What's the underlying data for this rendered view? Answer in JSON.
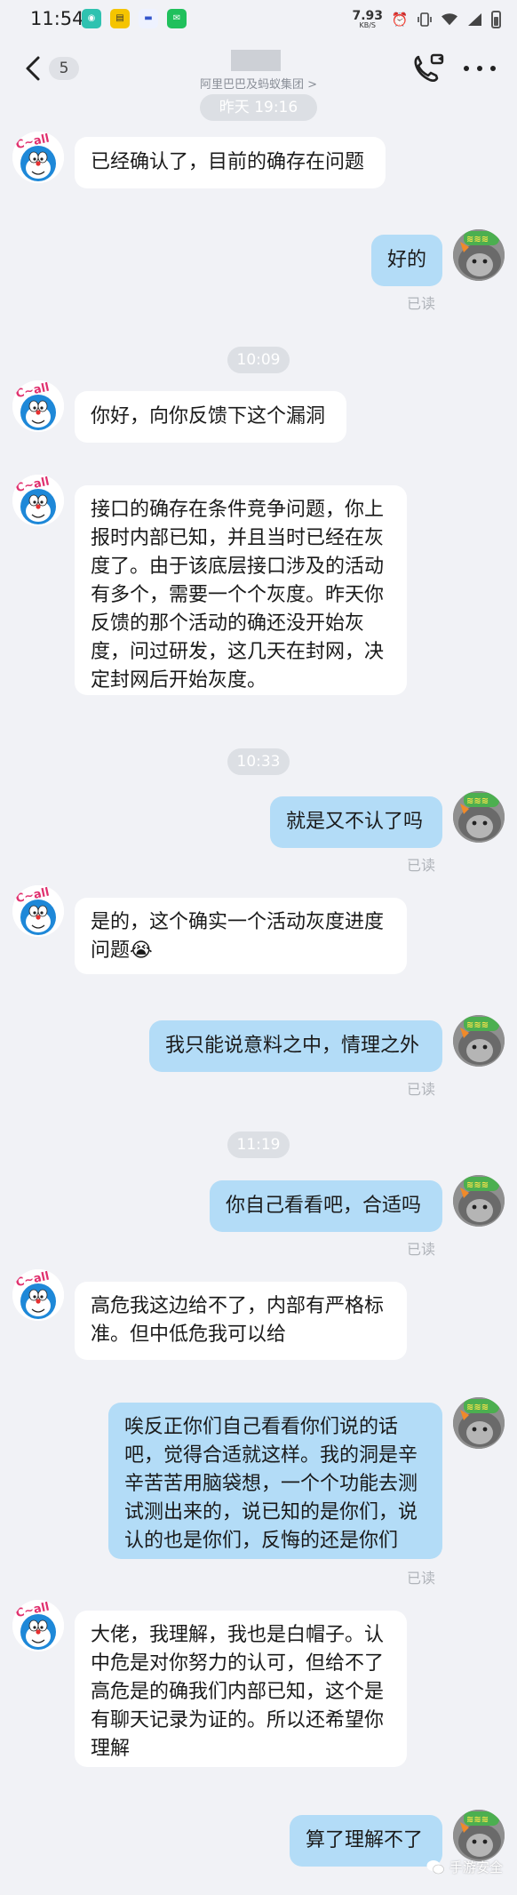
{
  "status_bar": {
    "time": "11:54",
    "net_speed": "7.93",
    "net_unit": "KB/S"
  },
  "nav": {
    "unread_count": "5",
    "subtitle": "阿里巴巴及蚂蚁集团 >"
  },
  "timestamps": [
    "昨天 19:16",
    "10:09",
    "10:33",
    "11:19"
  ],
  "read_label": "已读",
  "messages": [
    {
      "side": "left",
      "text": "已经确认了，目前的确存在问题"
    },
    {
      "side": "right",
      "text": "好的",
      "read": true
    },
    {
      "side": "left",
      "text": "你好，向你反馈下这个漏洞"
    },
    {
      "side": "left",
      "text": "接口的确存在条件竞争问题，你上\n报时内部已知，并且当时已经在灰\n度了。由于该底层接口涉及的活动\n有多个，需要一个个灰度。昨天你\n反馈的那个活动的确还没开始灰\n度，问过研发，这几天在封网，决\n定封网后开始灰度。"
    },
    {
      "side": "right",
      "text": "就是又不认了吗",
      "read": true
    },
    {
      "side": "left",
      "text": "是的，这个确实一个活动灰度进度\n问题😭"
    },
    {
      "side": "right",
      "text": "我只能说意料之中，情理之外",
      "read": true
    },
    {
      "side": "right",
      "text": "你自己看看吧，合适吗",
      "read": true
    },
    {
      "side": "left",
      "text": "高危我这边给不了，内部有严格标\n准。但中低危我可以给"
    },
    {
      "side": "right",
      "text": "唉反正你们自己看看你们说的话\n吧，觉得合适就这样。我的洞是辛\n辛苦苦用脑袋想，一个个功能去测\n试测出来的，说已知的是你们，说\n认的也是你们，反悔的还是你们",
      "read": true
    },
    {
      "side": "left",
      "text": "大佬，我理解，我也是白帽子。认\n中危是对你努力的认可，但给不了\n高危是的确我们内部已知，这个是\n有聊天记录为证的。所以还希望你\n理解"
    },
    {
      "side": "right",
      "text": "算了理解不了",
      "read": false
    }
  ],
  "watermark": "手游安全",
  "icons": [
    "back-icon",
    "phone-call-icon",
    "more-icon",
    "wifi-icon",
    "signal-icon",
    "alarm-icon",
    "vibrate-icon",
    "battery-icon",
    "wechat-icon"
  ]
}
